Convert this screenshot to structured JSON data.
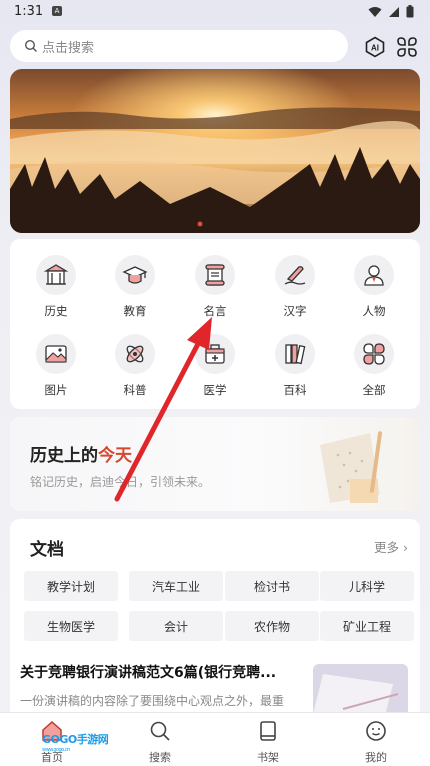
{
  "status_bar": {
    "time": "1:31",
    "notif_badge": "A"
  },
  "search": {
    "placeholder": "点击搜索",
    "ai_label": "AI"
  },
  "categories": [
    {
      "label": "历史",
      "icon": "history-building-icon"
    },
    {
      "label": "教育",
      "icon": "graduation-cap-icon"
    },
    {
      "label": "名言",
      "icon": "scroll-icon"
    },
    {
      "label": "汉字",
      "icon": "pen-icon"
    },
    {
      "label": "人物",
      "icon": "person-icon"
    },
    {
      "label": "图片",
      "icon": "image-icon"
    },
    {
      "label": "科普",
      "icon": "atom-icon"
    },
    {
      "label": "医学",
      "icon": "medical-kit-icon"
    },
    {
      "label": "百科",
      "icon": "books-icon"
    },
    {
      "label": "全部",
      "icon": "all-grid-icon"
    }
  ],
  "today": {
    "title_prefix": "历史上的",
    "title_highlight": "今天",
    "subtitle": "铭记历史，启迪今日，引领未来。"
  },
  "docs": {
    "title": "文档",
    "more": "更多",
    "tags": [
      "教学计划",
      "汽车工业",
      "检讨书",
      "儿科学",
      "生物医学",
      "会计",
      "农作物",
      "矿业工程"
    ],
    "article": {
      "title": "关于竞聘银行演讲稿范文6篇(银行竞聘...",
      "desc": "一份演讲稿的内容除了要围绕中心观点之外，最重"
    }
  },
  "tabs": [
    {
      "label": "首页",
      "icon": "home-icon"
    },
    {
      "label": "搜索",
      "icon": "search-icon"
    },
    {
      "label": "书架",
      "icon": "bookshelf-icon"
    },
    {
      "label": "我的",
      "icon": "profile-icon"
    }
  ],
  "watermark": {
    "brand": "GOGO手游网",
    "url": "www.gogo.cn"
  },
  "colors": {
    "accent_red": "#d6472f",
    "arrow_red": "#e0262b",
    "watermark_blue": "#1e9be6"
  }
}
